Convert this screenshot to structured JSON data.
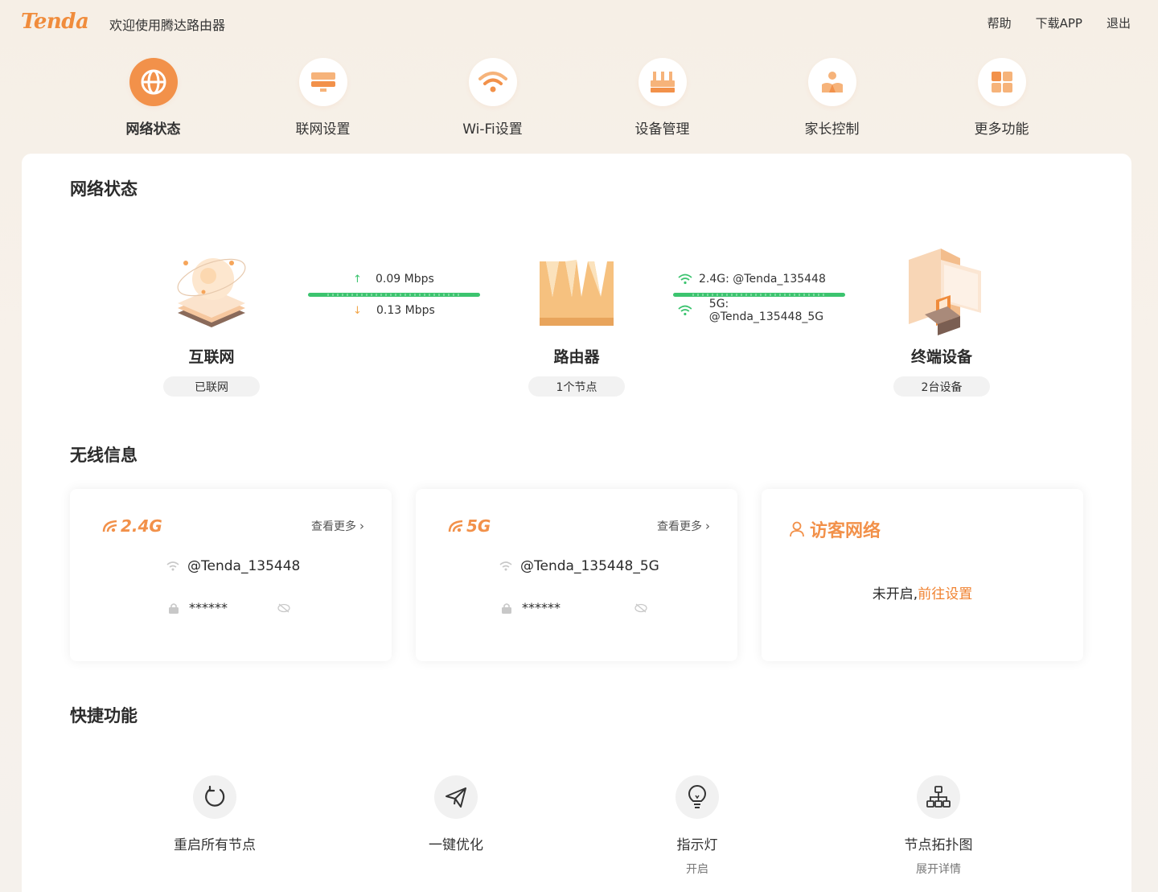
{
  "header": {
    "logo": "Tenda",
    "welcome": "欢迎使用腾达路由器",
    "links": [
      "帮助",
      "下载APP",
      "退出"
    ]
  },
  "nav": {
    "active_index": 0,
    "items": [
      {
        "label": "网络状态",
        "icon": "globe-icon"
      },
      {
        "label": "联网设置",
        "icon": "monitor-icon"
      },
      {
        "label": "Wi-Fi设置",
        "icon": "wifi-icon"
      },
      {
        "label": "设备管理",
        "icon": "router-icon"
      },
      {
        "label": "家长控制",
        "icon": "parent-icon"
      },
      {
        "label": "更多功能",
        "icon": "grid-icon"
      }
    ]
  },
  "network_status": {
    "title": "网络状态",
    "internet": {
      "name": "互联网",
      "status": "已联网"
    },
    "traffic": {
      "up": "0.09 Mbps",
      "down": "0.13 Mbps"
    },
    "router": {
      "name": "路由器",
      "status": "1个节点"
    },
    "wifi_links": {
      "band24": "2.4G: @Tenda_135448",
      "band5": "5G: @Tenda_135448_5G"
    },
    "terminals": {
      "name": "终端设备",
      "status": "2台设备"
    }
  },
  "wireless": {
    "title": "无线信息",
    "card24": {
      "band": "2.4G",
      "more": "查看更多",
      "ssid": "@Tenda_135448",
      "password": "******"
    },
    "card5": {
      "band": "5G",
      "more": "查看更多",
      "ssid": "@Tenda_135448_5G",
      "password": "******"
    },
    "guest": {
      "title": "访客网络",
      "status_prefix": "未开启,",
      "link": "前往设置"
    }
  },
  "quick": {
    "title": "快捷功能",
    "items": [
      {
        "label": "重启所有节点",
        "sub": ""
      },
      {
        "label": "一键优化",
        "sub": ""
      },
      {
        "label": "指示灯",
        "sub": "开启"
      },
      {
        "label": "节点拓扑图",
        "sub": "展开详情"
      }
    ]
  },
  "colors": {
    "accent": "#f2914a",
    "link": "#f08230",
    "link_bar": "#3cc46f"
  }
}
